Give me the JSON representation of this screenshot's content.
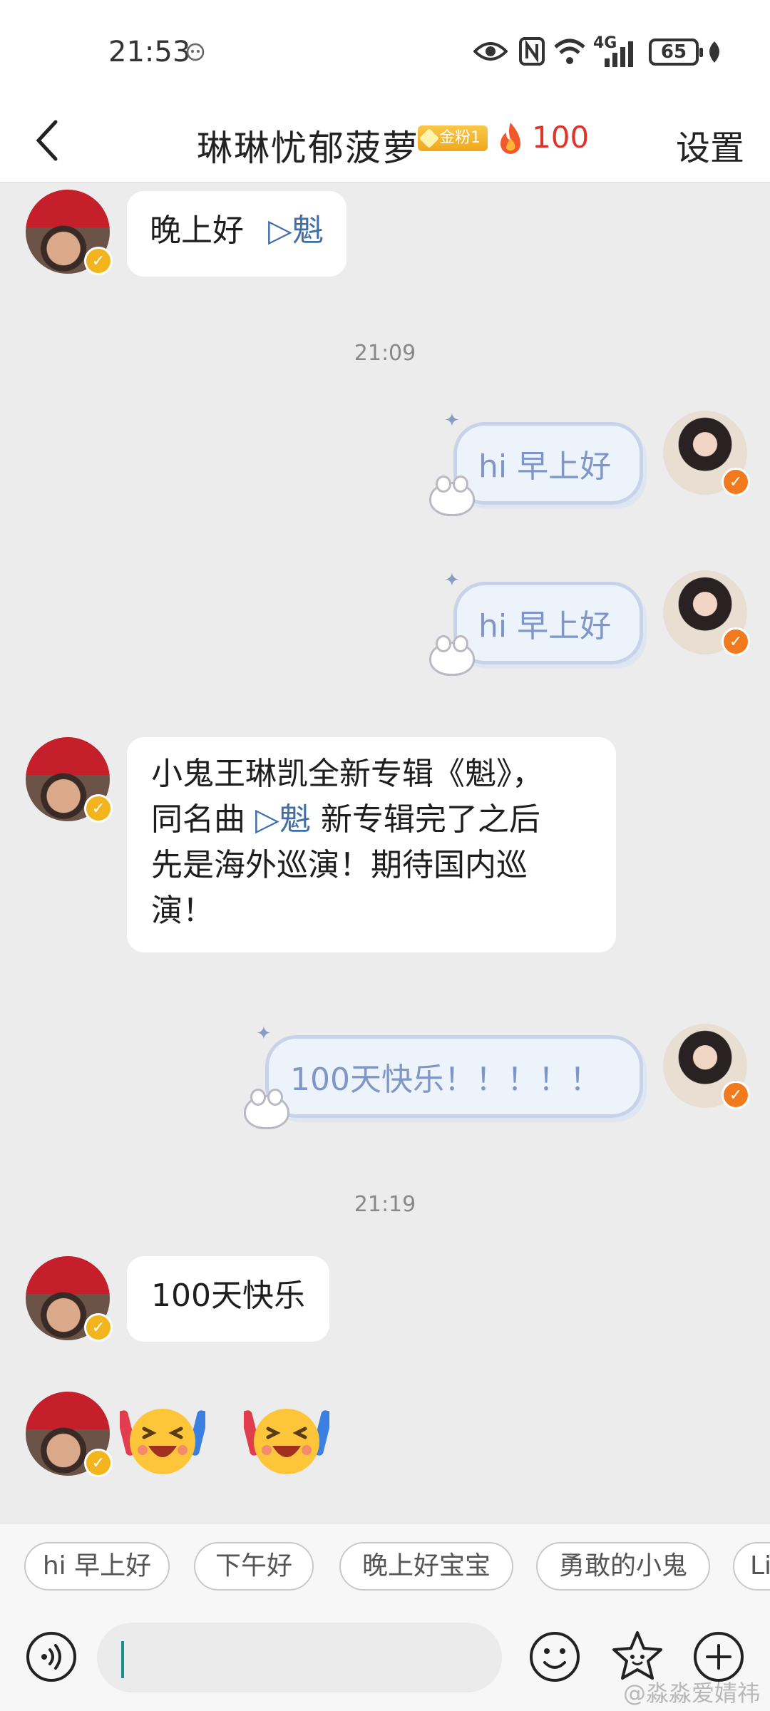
{
  "status_bar": {
    "time": "21:53",
    "network": "4G",
    "battery": "65"
  },
  "header": {
    "title": "琳琳忧郁菠萝",
    "fan_badge": "金粉1",
    "fire_count": "100",
    "settings_label": "设置"
  },
  "messages": {
    "m1_text": "晚上好",
    "m1_song": "▷魁",
    "time1": "21:09",
    "m2_text": "hi 早上好",
    "m3_text": "hi 早上好",
    "m4_line1": "小鬼王琳凯全新专辑《魁》，",
    "m4_line2_prefix": "同名曲 ",
    "m4_line2_song": "▷魁",
    "m4_line2_suffix": " 新专辑完了之后",
    "m4_line3": "先是海外巡演！期待国内巡",
    "m4_line4": "演！",
    "m5_text": "100天快乐！！！！！",
    "time2": "21:19",
    "m6_text": "100天快乐",
    "m7_emojis": [
      "laughing-cheering-emoji",
      "laughing-cheering-emoji"
    ]
  },
  "quick_replies": [
    "hi 早上好",
    "下午好",
    "晚上好宝宝",
    "勇敢的小鬼",
    "Li"
  ],
  "input": {
    "placeholder": ""
  },
  "watermark": "@淼淼爱婧祎",
  "colors": {
    "background": "#ececec",
    "fire": "#e0342b",
    "link": "#3f6ea8",
    "themed_bubble_text": "#7f97c8",
    "caret": "#1a8f8a"
  },
  "icons": [
    "back-arrow-icon",
    "eye-icon",
    "nfc-icon",
    "wifi-icon",
    "signal-icon",
    "battery-icon",
    "leaf-icon",
    "flame-icon",
    "voice-icon",
    "emoji-icon",
    "star-face-icon",
    "plus-icon"
  ]
}
